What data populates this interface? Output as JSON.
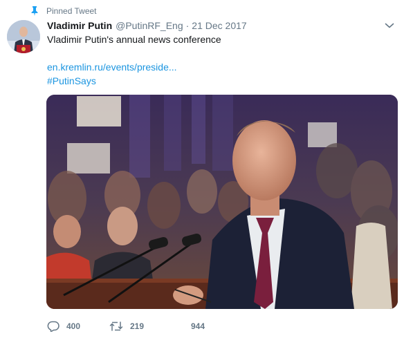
{
  "pinned": {
    "label": "Pinned Tweet",
    "icon": "pin-icon"
  },
  "tweet": {
    "display_name": "Vladimir Putin",
    "handle": "@PutinRF_Eng",
    "separator": "·",
    "date": "21 Dec 2017",
    "text": "Vladimir Putin's annual news conference",
    "link": "en.kremlin.ru/events/preside...",
    "hashtag": "#PutinSays",
    "media_alt": "Photo"
  },
  "actions": {
    "reply_count": "400",
    "retweet_count": "219",
    "like_count": "944"
  },
  "colors": {
    "link": "#1b95e0",
    "secondary_text": "#657786",
    "pin": "#1da1f2"
  }
}
